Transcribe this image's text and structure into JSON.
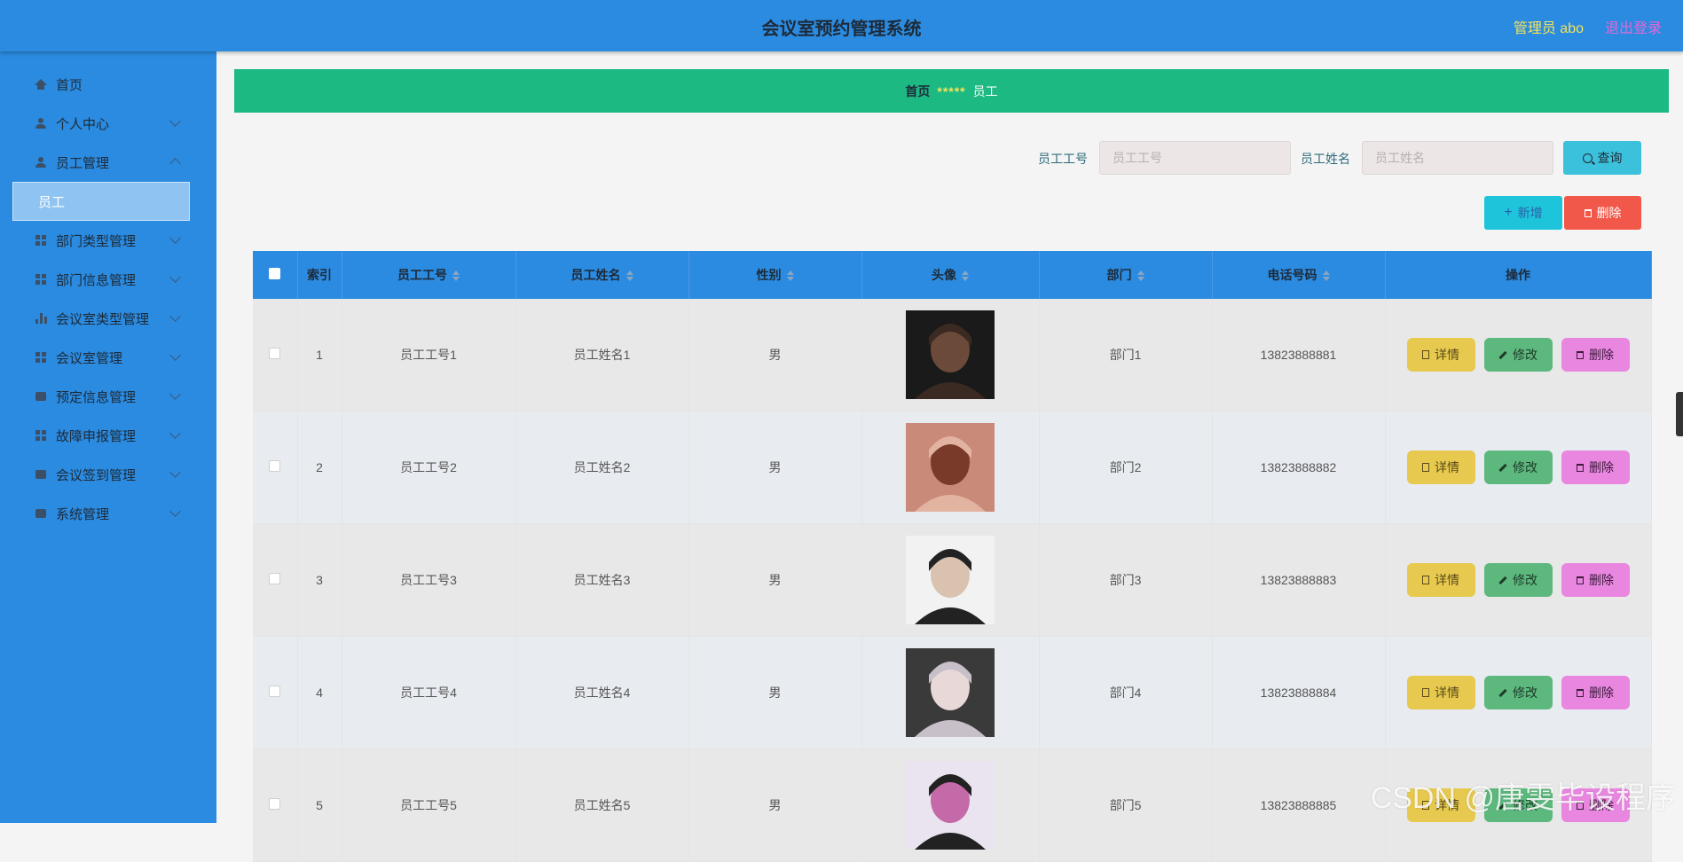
{
  "header": {
    "title": "会议室预约管理系统",
    "user": "管理员 abo",
    "logout": "退出登录"
  },
  "sidebar": {
    "items": [
      {
        "label": "首页",
        "icon": "home-icon"
      },
      {
        "label": "个人中心",
        "icon": "person-icon"
      },
      {
        "label": "员工管理",
        "icon": "person-icon"
      },
      {
        "label": "部门类型管理",
        "icon": "grid-icon"
      },
      {
        "label": "部门信息管理",
        "icon": "grid-icon"
      },
      {
        "label": "会议室类型管理",
        "icon": "bar-chart-icon"
      },
      {
        "label": "会议室管理",
        "icon": "grid-icon"
      },
      {
        "label": "预定信息管理",
        "icon": "box-icon"
      },
      {
        "label": "故障申报管理",
        "icon": "grid-icon"
      },
      {
        "label": "会议签到管理",
        "icon": "box-icon"
      },
      {
        "label": "系统管理",
        "icon": "box-icon"
      }
    ],
    "active_sub": "员工"
  },
  "breadcrumb": {
    "home": "首页",
    "sep": "*****",
    "current": "员工"
  },
  "search": {
    "id_label": "员工工号",
    "id_placeholder": "员工工号",
    "name_label": "员工姓名",
    "name_placeholder": "员工姓名",
    "query": "查询"
  },
  "toolbar": {
    "add": "新增",
    "delete": "删除"
  },
  "table": {
    "headers": [
      "索引",
      "员工工号",
      "员工姓名",
      "性别",
      "头像",
      "部门",
      "电话号码",
      "操作"
    ],
    "rows": [
      {
        "idx": "1",
        "id": "员工工号1",
        "name": "员工姓名1",
        "gender": "男",
        "dept": "部门1",
        "phone": "13823888881"
      },
      {
        "idx": "2",
        "id": "员工工号2",
        "name": "员工姓名2",
        "gender": "男",
        "dept": "部门2",
        "phone": "13823888882"
      },
      {
        "idx": "3",
        "id": "员工工号3",
        "name": "员工姓名3",
        "gender": "男",
        "dept": "部门3",
        "phone": "13823888883"
      },
      {
        "idx": "4",
        "id": "员工工号4",
        "name": "员工姓名4",
        "gender": "男",
        "dept": "部门4",
        "phone": "13823888884"
      },
      {
        "idx": "5",
        "id": "员工工号5",
        "name": "员工姓名5",
        "gender": "男",
        "dept": "部门5",
        "phone": "13823888885"
      }
    ],
    "actions": {
      "detail": "详情",
      "edit": "修改",
      "delete": "删除"
    }
  },
  "watermark": "CSDN @唐雯毕设程序"
}
